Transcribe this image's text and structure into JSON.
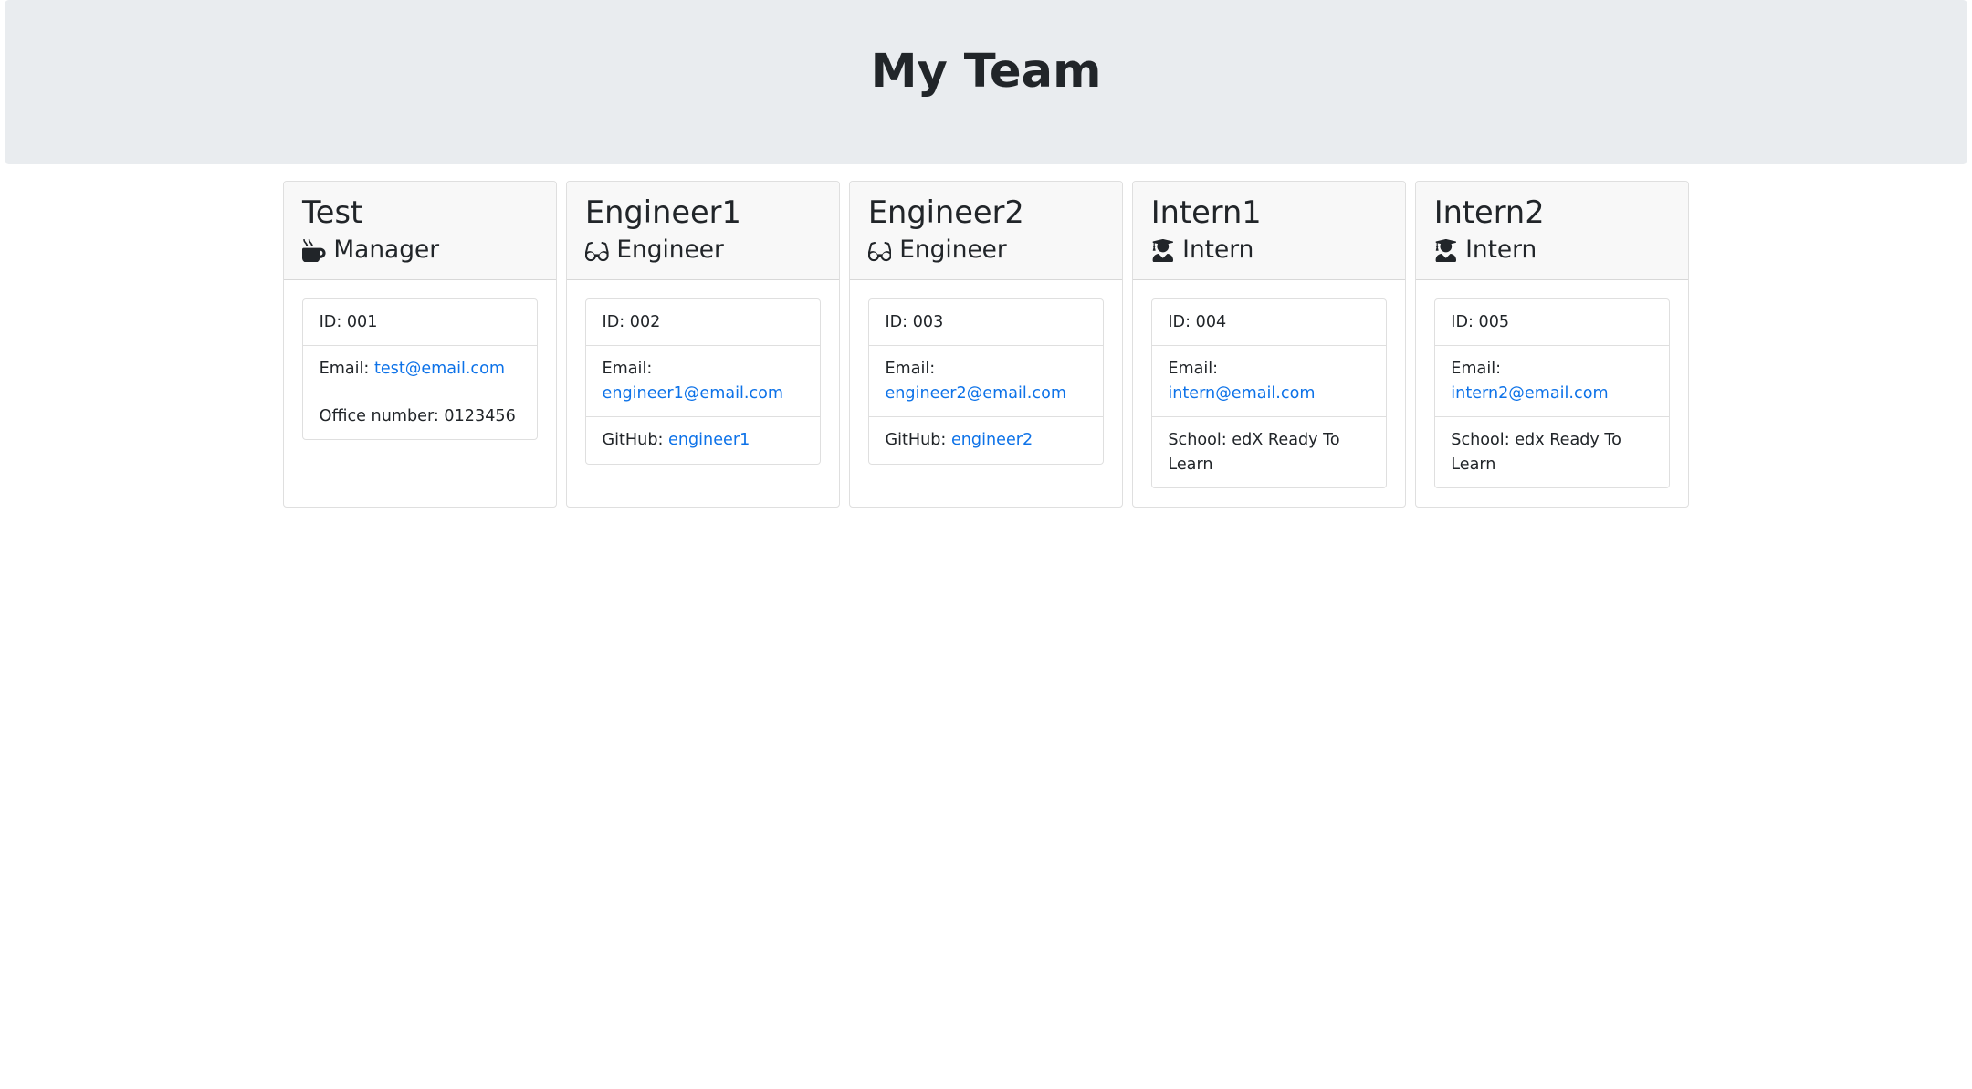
{
  "header": {
    "title": "My Team"
  },
  "labels": {
    "id_prefix": "ID: ",
    "email_prefix": "Email: ",
    "office_prefix": "Office number: ",
    "github_prefix": "GitHub: ",
    "school_prefix": "School: "
  },
  "roles": {
    "manager": "Manager",
    "engineer": "Engineer",
    "intern": "Intern"
  },
  "icons": {
    "manager": "mug-hot-icon",
    "engineer": "glasses-icon",
    "intern": "graduate-icon"
  },
  "team": [
    {
      "name": "Test",
      "role_key": "manager",
      "id": "001",
      "email": "test@email.com",
      "extra_type": "office",
      "extra_value": "0123456"
    },
    {
      "name": "Engineer1",
      "role_key": "engineer",
      "id": "002",
      "email": "engineer1@email.com",
      "extra_type": "github",
      "extra_value": "engineer1"
    },
    {
      "name": "Engineer2",
      "role_key": "engineer",
      "id": "003",
      "email": "engineer2@email.com",
      "extra_type": "github",
      "extra_value": "engineer2"
    },
    {
      "name": "Intern1",
      "role_key": "intern",
      "id": "004",
      "email": "intern@email.com",
      "extra_type": "school",
      "extra_value": "edX Ready To Learn"
    },
    {
      "name": "Intern2",
      "role_key": "intern",
      "id": "005",
      "email": "intern2@email.com",
      "extra_type": "school",
      "extra_value": "edx Ready To Learn"
    }
  ]
}
